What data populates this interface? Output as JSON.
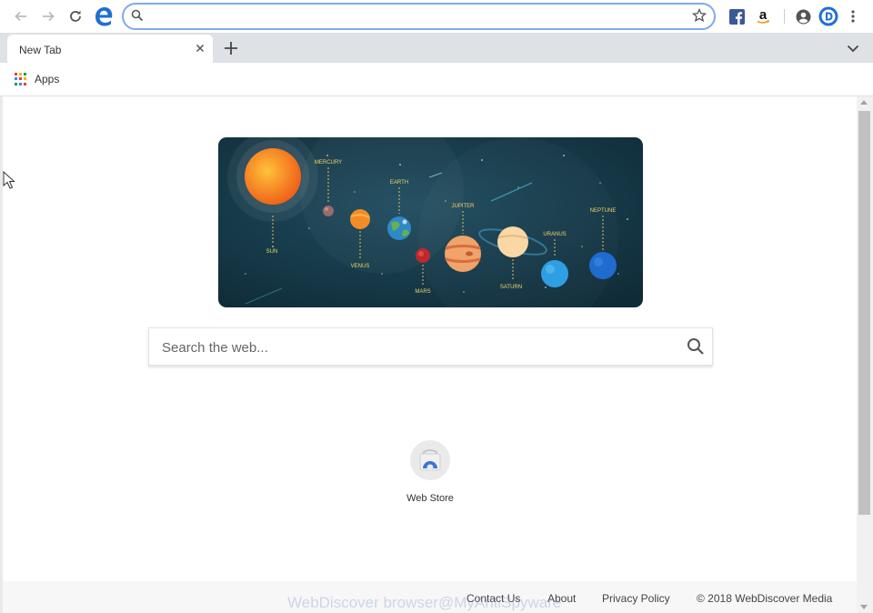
{
  "tab": {
    "title": "New Tab"
  },
  "omnibox": {
    "value": ""
  },
  "bookmarks": {
    "apps_label": "Apps"
  },
  "banner": {
    "planets": [
      "SUN",
      "MERCURY",
      "VENUS",
      "EARTH",
      "MARS",
      "JUPITER",
      "SATURN",
      "URANUS",
      "NEPTUNE"
    ]
  },
  "search": {
    "placeholder": "Search the web..."
  },
  "shortcut": {
    "label": "Web Store"
  },
  "footer": {
    "contact": "Contact Us",
    "about": "About",
    "privacy": "Privacy Policy",
    "copyright": "© 2018 WebDiscover Media"
  },
  "watermark": "WebDiscover browser@MyAntiSpyware",
  "colors": {
    "accent": "#7eaaeb",
    "banner_bg": "#173b4d",
    "facebook": "#3b5998",
    "edge": "#1f6fd0"
  }
}
